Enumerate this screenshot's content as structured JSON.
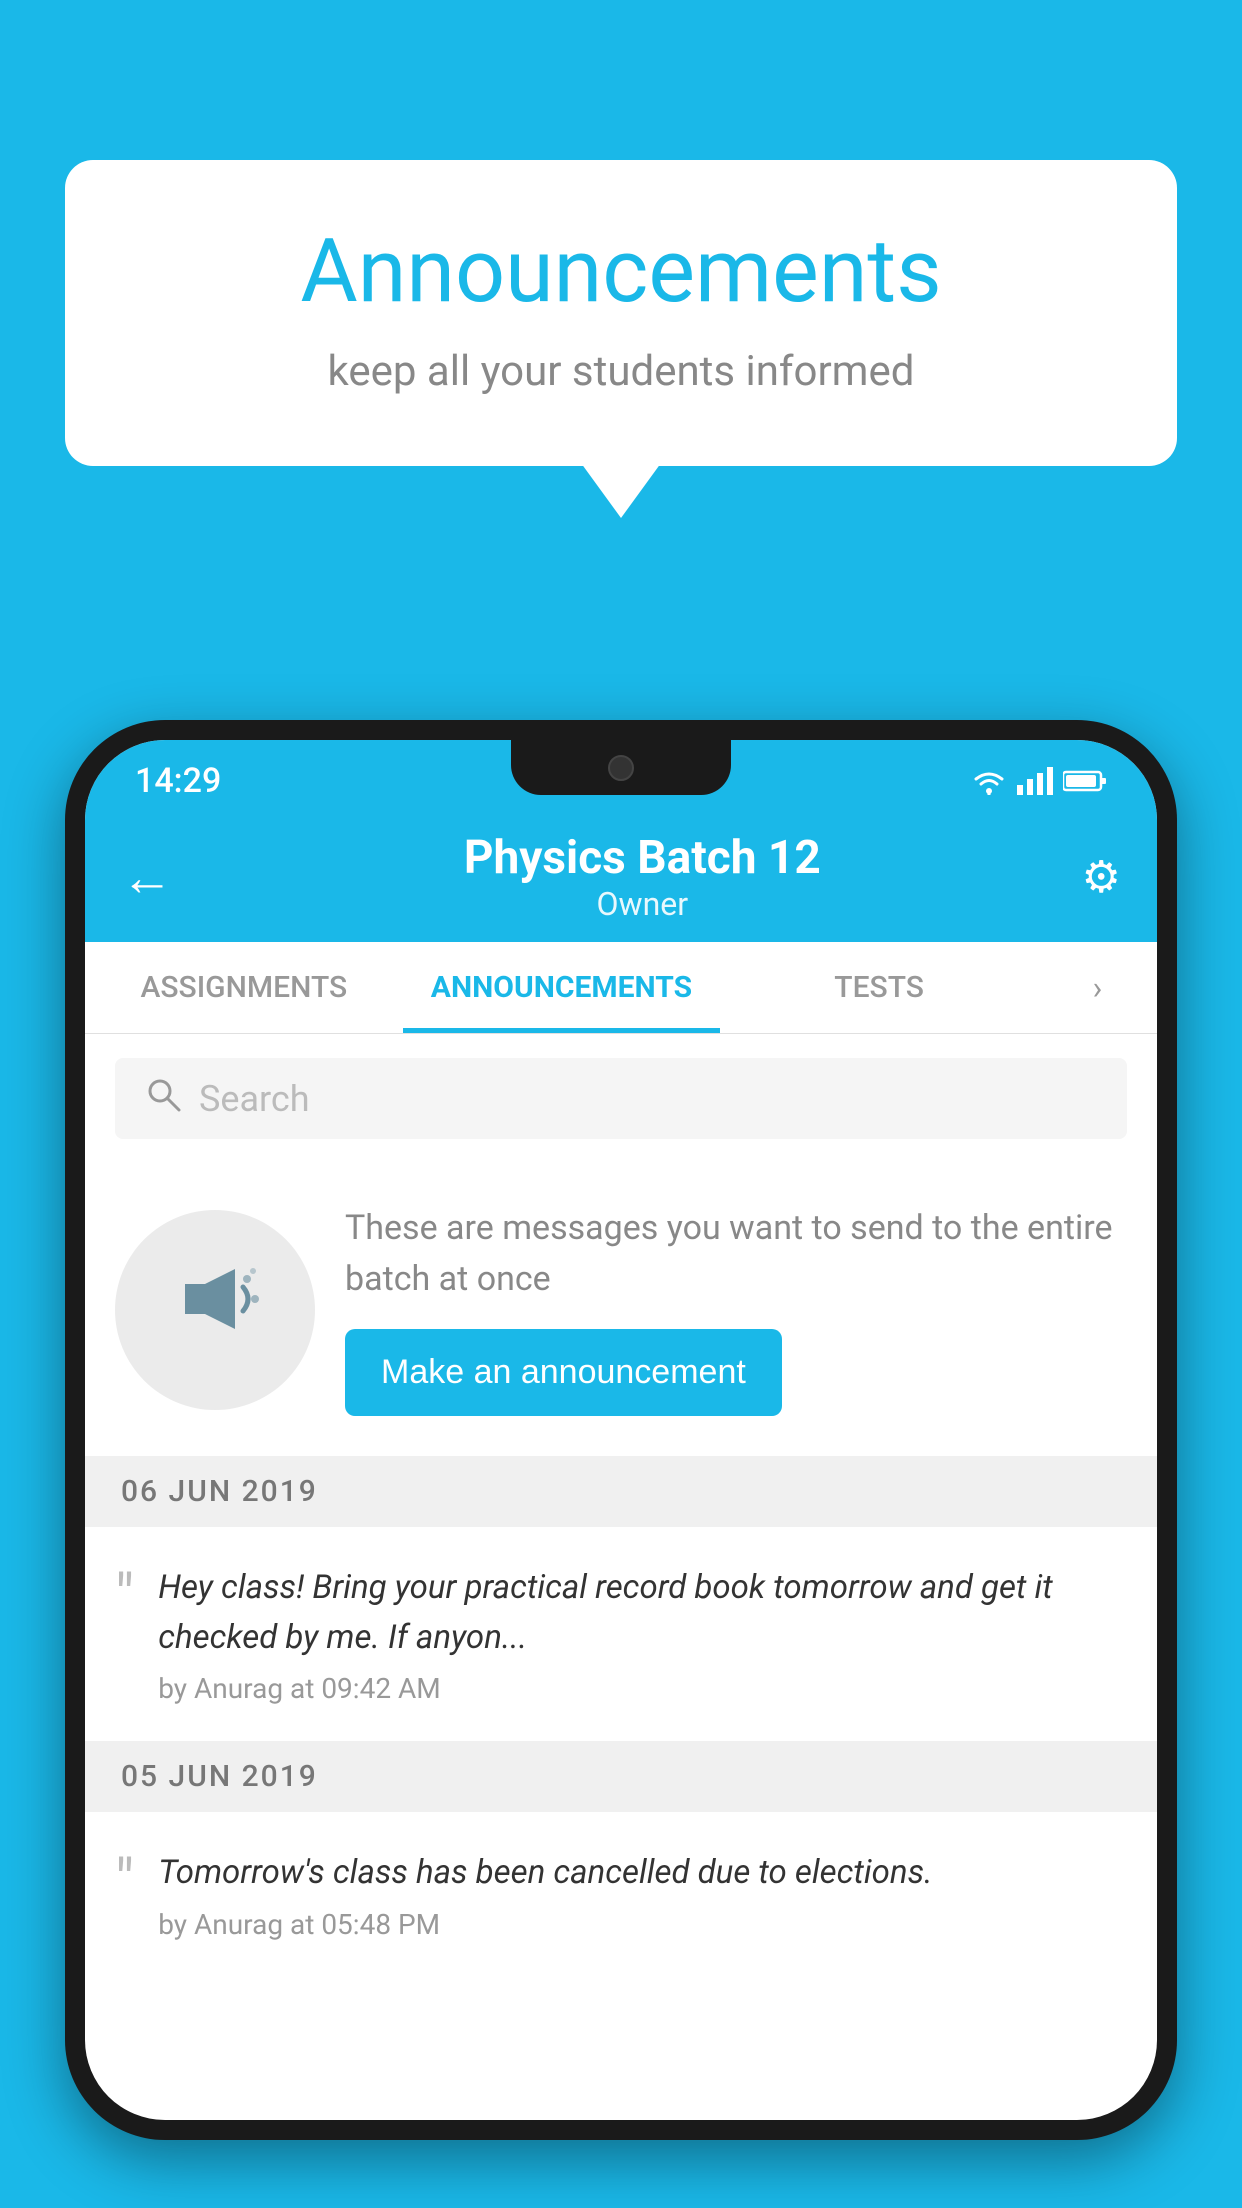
{
  "bubble": {
    "title": "Announcements",
    "subtitle": "keep all your students informed"
  },
  "statusBar": {
    "time": "14:29"
  },
  "appBar": {
    "title": "Physics Batch 12",
    "subtitle": "Owner",
    "backLabel": "←",
    "settingsLabel": "⚙"
  },
  "tabs": [
    {
      "label": "ASSIGNMENTS",
      "active": false
    },
    {
      "label": "ANNOUNCEMENTS",
      "active": true
    },
    {
      "label": "TESTS",
      "active": false
    }
  ],
  "search": {
    "placeholder": "Search"
  },
  "announcementPrompt": {
    "text": "These are messages you want to send to the entire batch at once",
    "buttonLabel": "Make an announcement"
  },
  "dateSections": [
    {
      "date": "06  JUN  2019",
      "messages": [
        {
          "text": "Hey class! Bring your practical record book tomorrow and get it checked by me. If anyon...",
          "meta": "by Anurag at 09:42 AM"
        }
      ]
    },
    {
      "date": "05  JUN  2019",
      "messages": [
        {
          "text": "Tomorrow's class has been cancelled due to elections.",
          "meta": "by Anurag at 05:48 PM"
        }
      ]
    }
  ]
}
